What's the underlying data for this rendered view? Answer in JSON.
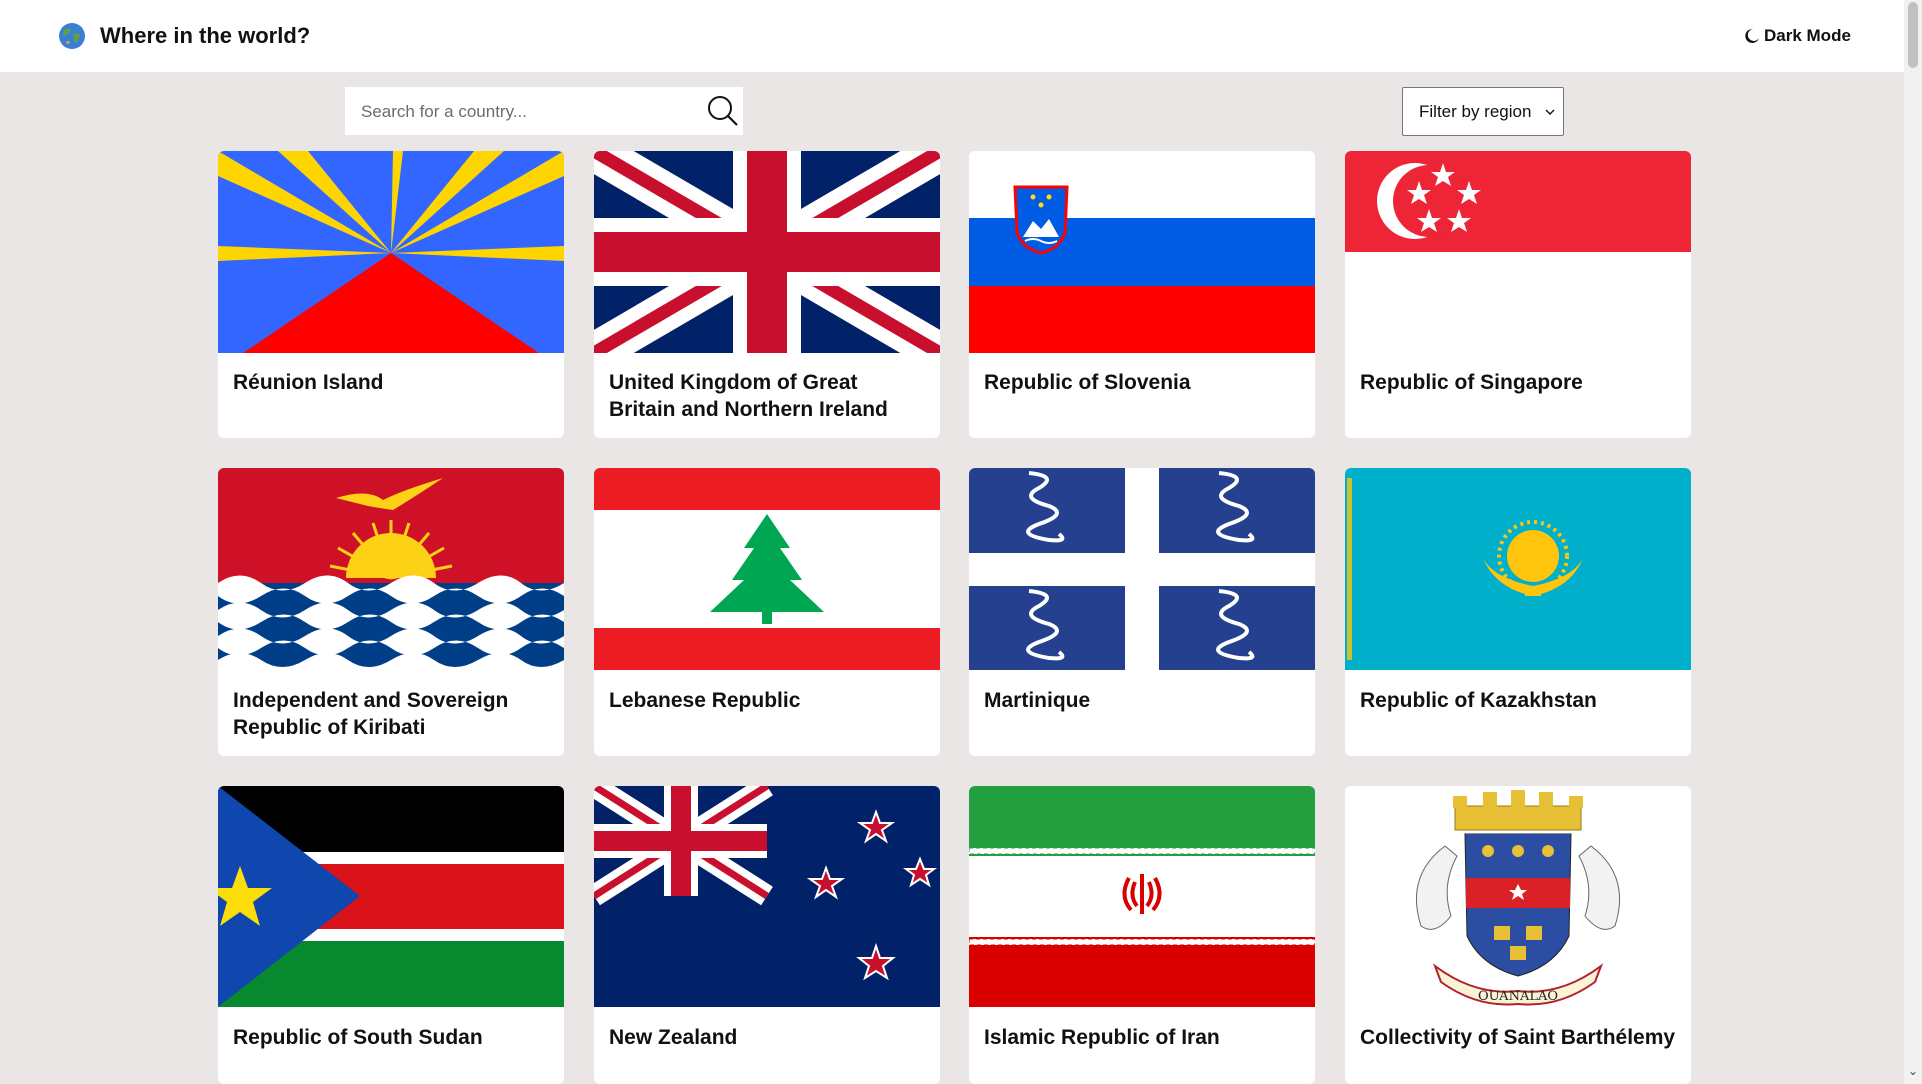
{
  "header": {
    "title": "Where in the world?",
    "dark_mode_label": "Dark Mode"
  },
  "search": {
    "placeholder": "Search for a country..."
  },
  "filter": {
    "label": "Filter by region"
  },
  "countries": [
    {
      "name": "Réunion Island"
    },
    {
      "name": "United Kingdom of Great Britain and Northern Ireland"
    },
    {
      "name": "Republic of Slovenia"
    },
    {
      "name": "Republic of Singapore"
    },
    {
      "name": "Independent and Sovereign Republic of Kiribati"
    },
    {
      "name": "Lebanese Republic"
    },
    {
      "name": "Martinique"
    },
    {
      "name": "Republic of Kazakhstan"
    },
    {
      "name": "Republic of South Sudan"
    },
    {
      "name": "New Zealand"
    },
    {
      "name": "Islamic Republic of Iran"
    },
    {
      "name": "Collectivity of Saint Barthélemy",
      "emblem_text": "OUANALAO"
    }
  ],
  "colors": {
    "background": "#eae6e5",
    "card": "#ffffff",
    "text": "#111111"
  }
}
